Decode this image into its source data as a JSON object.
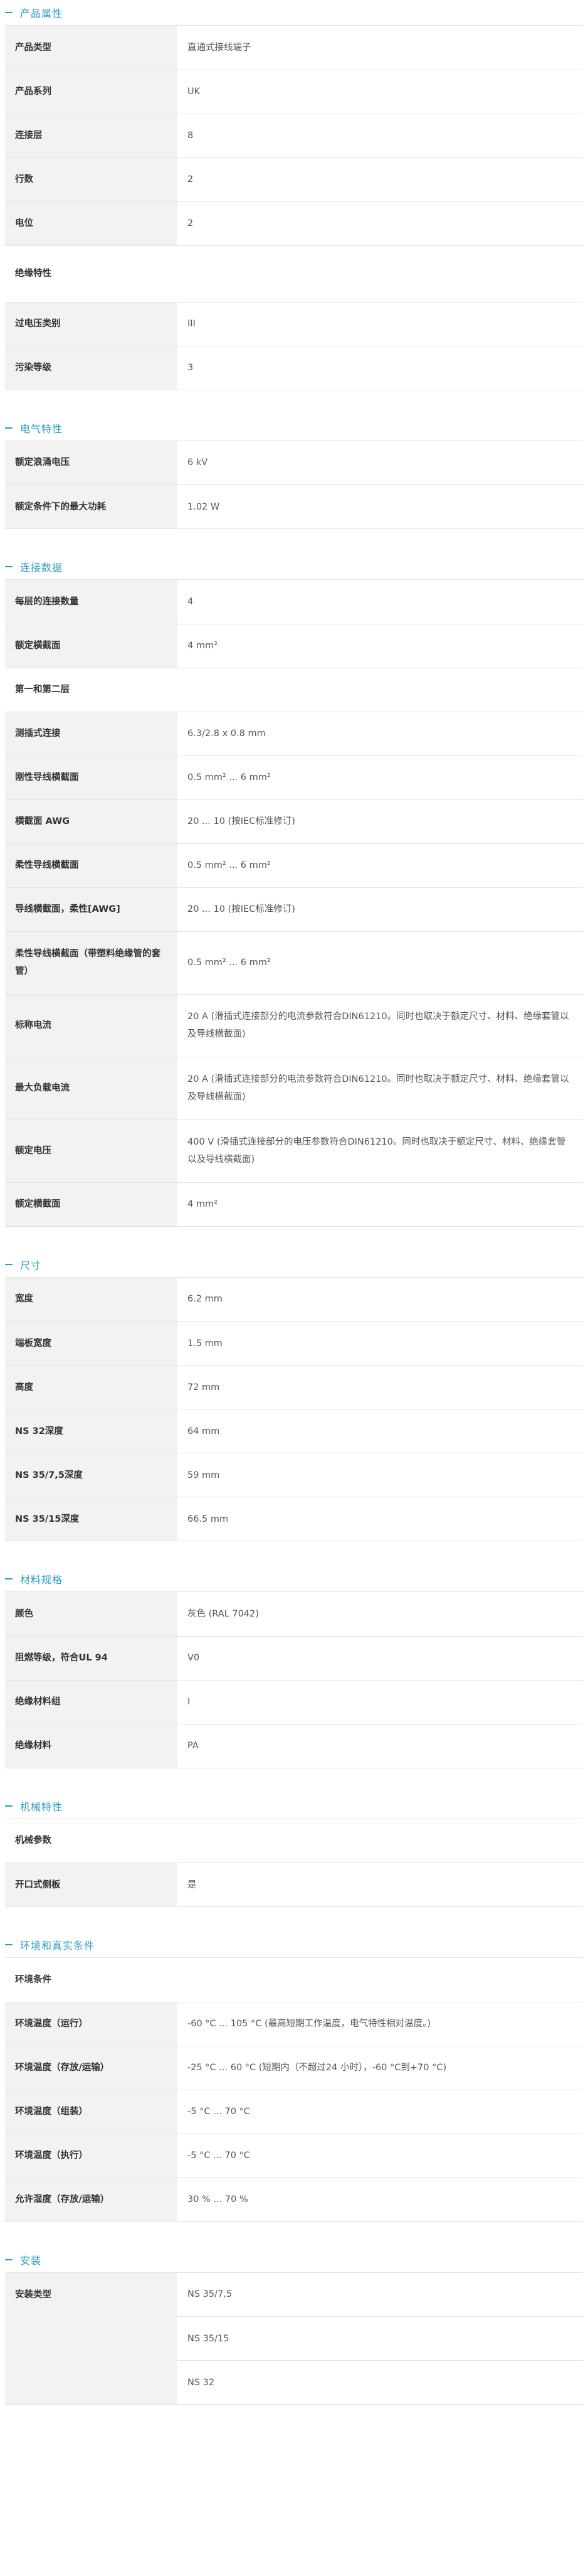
{
  "sections": [
    {
      "title": "产品属性",
      "rows": [
        {
          "type": "kv",
          "key": "产品类型",
          "value": "直通式接线端子",
          "h": 70
        },
        {
          "type": "kv",
          "key": "产品系列",
          "value": "UK",
          "h": 70
        },
        {
          "type": "kv",
          "key": "连接层",
          "value": "8",
          "h": 70
        },
        {
          "type": "kv",
          "key": "行数",
          "value": "2",
          "h": 70
        },
        {
          "type": "kv",
          "key": "电位",
          "value": "2",
          "h": 70
        },
        {
          "type": "sub",
          "label": "绝缘特性",
          "h": 90
        },
        {
          "type": "kv",
          "key": "过电压类别",
          "value": "III",
          "h": 70
        },
        {
          "type": "kv",
          "key": "污染等级",
          "value": "3",
          "h": 70
        }
      ]
    },
    {
      "title": "电气特性",
      "rows": [
        {
          "type": "kv",
          "key": "额定浪涌电压",
          "value": "6 kV",
          "h": 70
        },
        {
          "type": "kv",
          "key": "额定条件下的最大功耗",
          "value": "1.02 W",
          "h": 70
        }
      ]
    },
    {
      "title": "连接数据",
      "rows": [
        {
          "type": "kv",
          "key": "每层的连接数量",
          "value": "4",
          "h": 70
        },
        {
          "type": "kv",
          "key": "额定横截面",
          "value": "4 mm²",
          "h": 70
        },
        {
          "type": "sub",
          "label": "第一和第二层",
          "h": 70
        },
        {
          "type": "kv",
          "key": "测插式连接",
          "value": "6.3/2.8 x 0.8 mm",
          "h": 70
        },
        {
          "type": "kv",
          "key": "刚性导线横截面",
          "value": "0.5 mm² ... 6 mm²",
          "h": 70
        },
        {
          "type": "kv",
          "key": "横截面 AWG",
          "value": "20 ... 10 (按IEC标准修订)",
          "h": 70
        },
        {
          "type": "kv",
          "key": "柔性导线横截面",
          "value": "0.5 mm² ... 6 mm²",
          "h": 70
        },
        {
          "type": "kv",
          "key": "导线横截面，柔性[AWG]",
          "value": "20 ... 10 (按IEC标准修订)",
          "h": 70
        },
        {
          "type": "kv",
          "key": "柔性导线横截面（带塑料绝缘管的套管）",
          "value": "0.5 mm² ... 6 mm²",
          "h": 100
        },
        {
          "type": "kv",
          "key": "标称电流",
          "value": "20 A (滑插式连接部分的电流参数符合DIN61210。同时也取决于额定尺寸、材料、绝缘套管以及导线横截面)",
          "h": 100
        },
        {
          "type": "kv",
          "key": "最大负载电流",
          "value": "20 A (滑插式连接部分的电流参数符合DIN61210。同时也取决于额定尺寸、材料、绝缘套管以及导线横截面)",
          "h": 100
        },
        {
          "type": "kv",
          "key": "额定电压",
          "value": "400 V (滑插式连接部分的电压参数符合DIN61210。同时也取决于额定尺寸、材料、绝缘套管以及导线横截面)",
          "h": 100
        },
        {
          "type": "kv",
          "key": "额定横截面",
          "value": "4 mm²",
          "h": 70
        }
      ]
    },
    {
      "title": "尺寸",
      "rows": [
        {
          "type": "kv",
          "key": "宽度",
          "value": "6.2 mm",
          "h": 70
        },
        {
          "type": "kv",
          "key": "端板宽度",
          "value": "1.5 mm",
          "h": 70
        },
        {
          "type": "kv",
          "key": "高度",
          "value": "72 mm",
          "h": 70
        },
        {
          "type": "kv",
          "key": "NS 32深度",
          "value": "64 mm",
          "h": 70
        },
        {
          "type": "kv",
          "key": "NS 35/7,5深度",
          "value": "59 mm",
          "h": 70
        },
        {
          "type": "kv",
          "key": "NS 35/15深度",
          "value": "66.5 mm",
          "h": 70
        }
      ]
    },
    {
      "title": "材料规格",
      "rows": [
        {
          "type": "kv",
          "key": "颜色",
          "value": "灰色 (RAL 7042)",
          "h": 70
        },
        {
          "type": "kv",
          "key": "阻燃等级，符合UL 94",
          "value": "V0",
          "h": 70
        },
        {
          "type": "kv",
          "key": "绝缘材料组",
          "value": "I",
          "h": 70
        },
        {
          "type": "kv",
          "key": "绝缘材料",
          "value": "PA",
          "h": 70
        }
      ]
    },
    {
      "title": "机械特性",
      "rows": [
        {
          "type": "sub",
          "label": "机械参数",
          "h": 70
        },
        {
          "type": "kv",
          "key": "开口式侧板",
          "value": "是",
          "h": 70
        }
      ]
    },
    {
      "title": "环境和真实条件",
      "rows": [
        {
          "type": "sub",
          "label": "环境条件",
          "h": 70
        },
        {
          "type": "kv",
          "key": "环境温度（运行）",
          "value": "-60 °C ... 105 °C (最高短期工作温度，电气特性相对温度。)",
          "h": 70
        },
        {
          "type": "kv",
          "key": "环境温度（存放/运输）",
          "value": "-25 °C ... 60 °C (短期内（不超过24 小时），-60 °C到+70 °C)",
          "h": 70
        },
        {
          "type": "kv",
          "key": "环境温度（组装）",
          "value": "-5 °C ... 70 °C",
          "h": 70
        },
        {
          "type": "kv",
          "key": "环境温度（执行）",
          "value": "-5 °C ... 70 °C",
          "h": 70
        },
        {
          "type": "kv",
          "key": "允许湿度（存放/运输）",
          "value": "30 % ... 70 %",
          "h": 70
        }
      ]
    },
    {
      "title": "安装",
      "rows": [
        {
          "type": "multi",
          "key": "安装类型",
          "values": [
            "NS 35/7,5",
            "NS 35/15",
            "NS 32"
          ],
          "h": 70
        }
      ]
    }
  ],
  "colors": {
    "accent": "#2b9ec1",
    "key_bg": "#f2f2f2",
    "border": "#e3e3e3"
  }
}
